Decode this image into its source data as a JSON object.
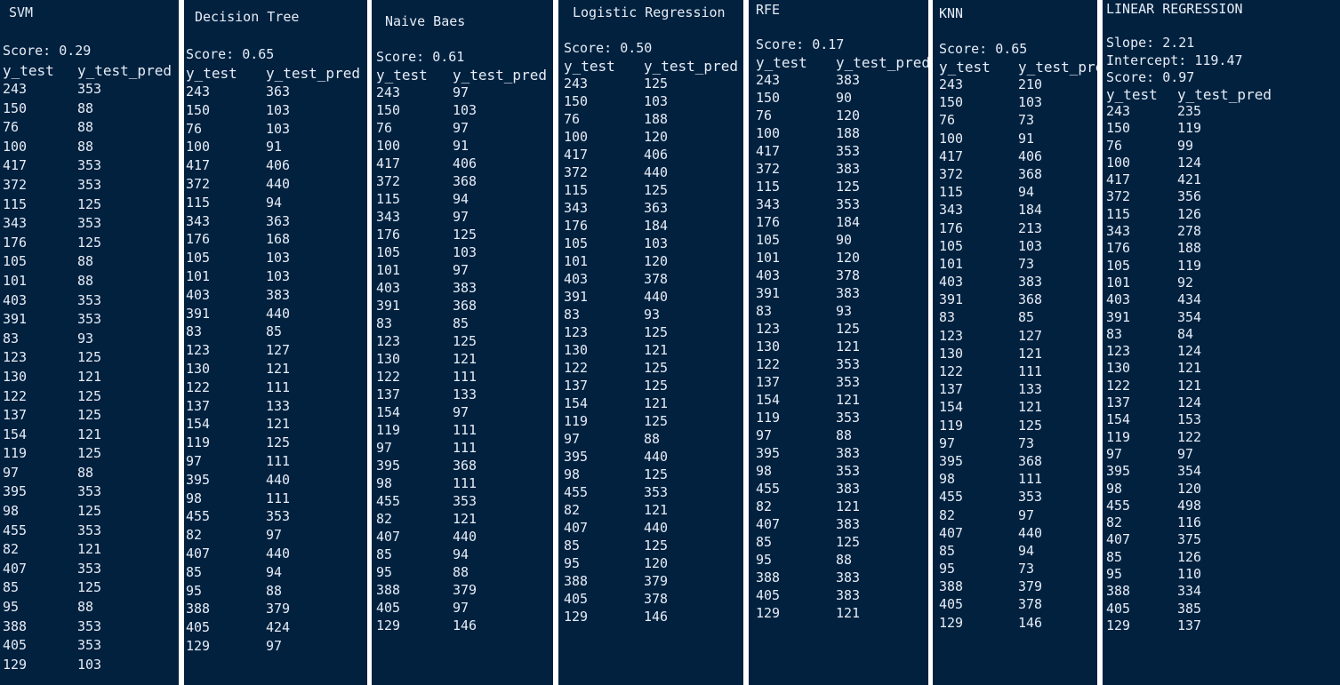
{
  "panels": [
    {
      "title": "SVM",
      "meta": [
        "Score: 0.29"
      ],
      "headers": [
        "y_test",
        "y_test_pred"
      ],
      "rows": [
        [
          "243",
          "353"
        ],
        [
          "150",
          "88"
        ],
        [
          "76",
          "88"
        ],
        [
          "100",
          "88"
        ],
        [
          "417",
          "353"
        ],
        [
          "372",
          "353"
        ],
        [
          "115",
          "125"
        ],
        [
          "343",
          "353"
        ],
        [
          "176",
          "125"
        ],
        [
          "105",
          "88"
        ],
        [
          "101",
          "88"
        ],
        [
          "403",
          "353"
        ],
        [
          "391",
          "353"
        ],
        [
          "83",
          "93"
        ],
        [
          "123",
          "125"
        ],
        [
          "130",
          "121"
        ],
        [
          "122",
          "125"
        ],
        [
          "137",
          "125"
        ],
        [
          "154",
          "121"
        ],
        [
          "119",
          "125"
        ],
        [
          "97",
          "88"
        ],
        [
          "395",
          "353"
        ],
        [
          "98",
          "125"
        ],
        [
          "455",
          "353"
        ],
        [
          "82",
          "121"
        ],
        [
          "407",
          "353"
        ],
        [
          "85",
          "125"
        ],
        [
          "95",
          "88"
        ],
        [
          "388",
          "353"
        ],
        [
          "405",
          "353"
        ],
        [
          "129",
          "103"
        ]
      ]
    },
    {
      "title": "Decision Tree",
      "meta": [
        "Score: 0.65"
      ],
      "headers": [
        "y_test",
        "y_test_pred"
      ],
      "rows": [
        [
          "243",
          "363"
        ],
        [
          "150",
          "103"
        ],
        [
          "76",
          "103"
        ],
        [
          "100",
          "91"
        ],
        [
          "417",
          "406"
        ],
        [
          "372",
          "440"
        ],
        [
          "115",
          "94"
        ],
        [
          "343",
          "363"
        ],
        [
          "176",
          "168"
        ],
        [
          "105",
          "103"
        ],
        [
          "101",
          "103"
        ],
        [
          "403",
          "383"
        ],
        [
          "391",
          "440"
        ],
        [
          "83",
          "85"
        ],
        [
          "123",
          "127"
        ],
        [
          "130",
          "121"
        ],
        [
          "122",
          "111"
        ],
        [
          "137",
          "133"
        ],
        [
          "154",
          "121"
        ],
        [
          "119",
          "125"
        ],
        [
          "97",
          "111"
        ],
        [
          "395",
          "440"
        ],
        [
          "98",
          "111"
        ],
        [
          "455",
          "353"
        ],
        [
          "82",
          "97"
        ],
        [
          "407",
          "440"
        ],
        [
          "85",
          "94"
        ],
        [
          "95",
          "88"
        ],
        [
          "388",
          "379"
        ],
        [
          "405",
          "424"
        ],
        [
          "129",
          "97"
        ]
      ]
    },
    {
      "title": "Naive Baes",
      "meta": [
        "Score: 0.61"
      ],
      "headers": [
        "y_test",
        "y_test_pred"
      ],
      "rows": [
        [
          "243",
          "97"
        ],
        [
          "150",
          "103"
        ],
        [
          "76",
          "97"
        ],
        [
          "100",
          "91"
        ],
        [
          "417",
          "406"
        ],
        [
          "372",
          "368"
        ],
        [
          "115",
          "94"
        ],
        [
          "343",
          "97"
        ],
        [
          "176",
          "125"
        ],
        [
          "105",
          "103"
        ],
        [
          "101",
          "97"
        ],
        [
          "403",
          "383"
        ],
        [
          "391",
          "368"
        ],
        [
          "83",
          "85"
        ],
        [
          "123",
          "125"
        ],
        [
          "130",
          "121"
        ],
        [
          "122",
          "111"
        ],
        [
          "137",
          "133"
        ],
        [
          "154",
          "97"
        ],
        [
          "119",
          "111"
        ],
        [
          "97",
          "111"
        ],
        [
          "395",
          "368"
        ],
        [
          "98",
          "111"
        ],
        [
          "455",
          "353"
        ],
        [
          "82",
          "121"
        ],
        [
          "407",
          "440"
        ],
        [
          "85",
          "94"
        ],
        [
          "95",
          "88"
        ],
        [
          "388",
          "379"
        ],
        [
          "405",
          "97"
        ],
        [
          "129",
          "146"
        ]
      ]
    },
    {
      "title": "Logistic Regression",
      "meta": [
        "Score: 0.50"
      ],
      "headers": [
        "y_test",
        "y_test_pred"
      ],
      "rows": [
        [
          "243",
          "125"
        ],
        [
          "150",
          "103"
        ],
        [
          "76",
          "188"
        ],
        [
          "100",
          "120"
        ],
        [
          "417",
          "406"
        ],
        [
          "372",
          "440"
        ],
        [
          "115",
          "125"
        ],
        [
          "343",
          "363"
        ],
        [
          "176",
          "184"
        ],
        [
          "105",
          "103"
        ],
        [
          "101",
          "120"
        ],
        [
          "403",
          "378"
        ],
        [
          "391",
          "440"
        ],
        [
          "83",
          "93"
        ],
        [
          "123",
          "125"
        ],
        [
          "130",
          "121"
        ],
        [
          "122",
          "125"
        ],
        [
          "137",
          "125"
        ],
        [
          "154",
          "121"
        ],
        [
          "119",
          "125"
        ],
        [
          "97",
          "88"
        ],
        [
          "395",
          "440"
        ],
        [
          "98",
          "125"
        ],
        [
          "455",
          "353"
        ],
        [
          "82",
          "121"
        ],
        [
          "407",
          "440"
        ],
        [
          "85",
          "125"
        ],
        [
          "95",
          "120"
        ],
        [
          "388",
          "379"
        ],
        [
          "405",
          "378"
        ],
        [
          "129",
          "146"
        ]
      ]
    },
    {
      "title": "RFE",
      "meta": [
        "Score: 0.17"
      ],
      "headers": [
        "y_test",
        "y_test_pred"
      ],
      "rows": [
        [
          "243",
          "383"
        ],
        [
          "150",
          "90"
        ],
        [
          "76",
          "120"
        ],
        [
          "100",
          "188"
        ],
        [
          "417",
          "353"
        ],
        [
          "372",
          "383"
        ],
        [
          "115",
          "125"
        ],
        [
          "343",
          "353"
        ],
        [
          "176",
          "184"
        ],
        [
          "105",
          "90"
        ],
        [
          "101",
          "120"
        ],
        [
          "403",
          "378"
        ],
        [
          "391",
          "383"
        ],
        [
          "83",
          "93"
        ],
        [
          "123",
          "125"
        ],
        [
          "130",
          "121"
        ],
        [
          "122",
          "353"
        ],
        [
          "137",
          "353"
        ],
        [
          "154",
          "121"
        ],
        [
          "119",
          "353"
        ],
        [
          "97",
          "88"
        ],
        [
          "395",
          "383"
        ],
        [
          "98",
          "353"
        ],
        [
          "455",
          "383"
        ],
        [
          "82",
          "121"
        ],
        [
          "407",
          "383"
        ],
        [
          "85",
          "125"
        ],
        [
          "95",
          "88"
        ],
        [
          "388",
          "383"
        ],
        [
          "405",
          "383"
        ],
        [
          "129",
          "121"
        ]
      ]
    },
    {
      "title": "KNN",
      "meta": [
        "Score: 0.65"
      ],
      "headers": [
        "y_test",
        "y_test_pred"
      ],
      "rows": [
        [
          "243",
          "210"
        ],
        [
          "150",
          "103"
        ],
        [
          "76",
          "73"
        ],
        [
          "100",
          "91"
        ],
        [
          "417",
          "406"
        ],
        [
          "372",
          "368"
        ],
        [
          "115",
          "94"
        ],
        [
          "343",
          "184"
        ],
        [
          "176",
          "213"
        ],
        [
          "105",
          "103"
        ],
        [
          "101",
          "73"
        ],
        [
          "403",
          "383"
        ],
        [
          "391",
          "368"
        ],
        [
          "83",
          "85"
        ],
        [
          "123",
          "127"
        ],
        [
          "130",
          "121"
        ],
        [
          "122",
          "111"
        ],
        [
          "137",
          "133"
        ],
        [
          "154",
          "121"
        ],
        [
          "119",
          "125"
        ],
        [
          "97",
          "73"
        ],
        [
          "395",
          "368"
        ],
        [
          "98",
          "111"
        ],
        [
          "455",
          "353"
        ],
        [
          "82",
          "97"
        ],
        [
          "407",
          "440"
        ],
        [
          "85",
          "94"
        ],
        [
          "95",
          "73"
        ],
        [
          "388",
          "379"
        ],
        [
          "405",
          "378"
        ],
        [
          "129",
          "146"
        ]
      ]
    },
    {
      "title": "LINEAR REGRESSION",
      "meta": [
        "Slope: 2.21",
        "Intercept: 119.47",
        "Score: 0.97"
      ],
      "headers": [
        "y_test",
        "y_test_pred"
      ],
      "rows": [
        [
          "243",
          "235"
        ],
        [
          "150",
          "119"
        ],
        [
          "76",
          "99"
        ],
        [
          "100",
          "124"
        ],
        [
          "417",
          "421"
        ],
        [
          "372",
          "356"
        ],
        [
          "115",
          "126"
        ],
        [
          "343",
          "278"
        ],
        [
          "176",
          "188"
        ],
        [
          "105",
          "119"
        ],
        [
          "101",
          "92"
        ],
        [
          "403",
          "434"
        ],
        [
          "391",
          "354"
        ],
        [
          "83",
          "84"
        ],
        [
          "123",
          "124"
        ],
        [
          "130",
          "121"
        ],
        [
          "122",
          "121"
        ],
        [
          "137",
          "124"
        ],
        [
          "154",
          "153"
        ],
        [
          "119",
          "122"
        ],
        [
          "97",
          "97"
        ],
        [
          "395",
          "354"
        ],
        [
          "98",
          "120"
        ],
        [
          "455",
          "498"
        ],
        [
          "82",
          "116"
        ],
        [
          "407",
          "375"
        ],
        [
          "85",
          "126"
        ],
        [
          "95",
          "110"
        ],
        [
          "388",
          "334"
        ],
        [
          "405",
          "385"
        ],
        [
          "129",
          "137"
        ]
      ]
    }
  ]
}
